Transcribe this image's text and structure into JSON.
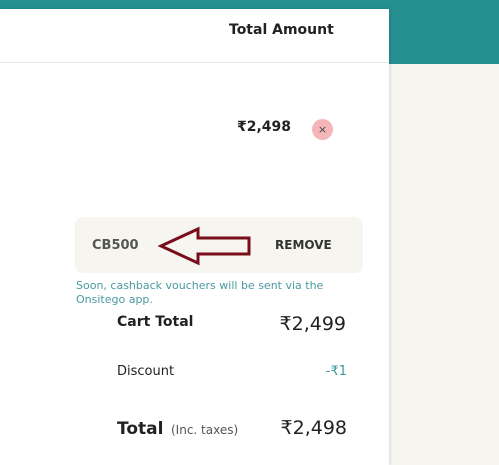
{
  "header": {
    "total_amount_label": "Total Amount"
  },
  "item": {
    "price": "₹2,498",
    "remove_symbol": "×"
  },
  "coupon": {
    "code": "CB500",
    "remove_label": "REMOVE",
    "note": "Soon, cashback vouchers will be sent via the Onsitego app."
  },
  "summary": {
    "cart_total_label": "Cart Total",
    "cart_total_value": "₹2,499",
    "discount_label": "Discount",
    "discount_value": "-₹1",
    "total_label": "Total",
    "total_tax_note": "(Inc. taxes)",
    "total_value": "₹2,498"
  },
  "colors": {
    "brand_teal": "#25908f",
    "annotation_arrow": "#7a0d1c",
    "remove_circle": "#f4b6b8"
  },
  "icons": {
    "item_remove": "close-icon",
    "annotation": "left-arrow-annotation-icon"
  }
}
